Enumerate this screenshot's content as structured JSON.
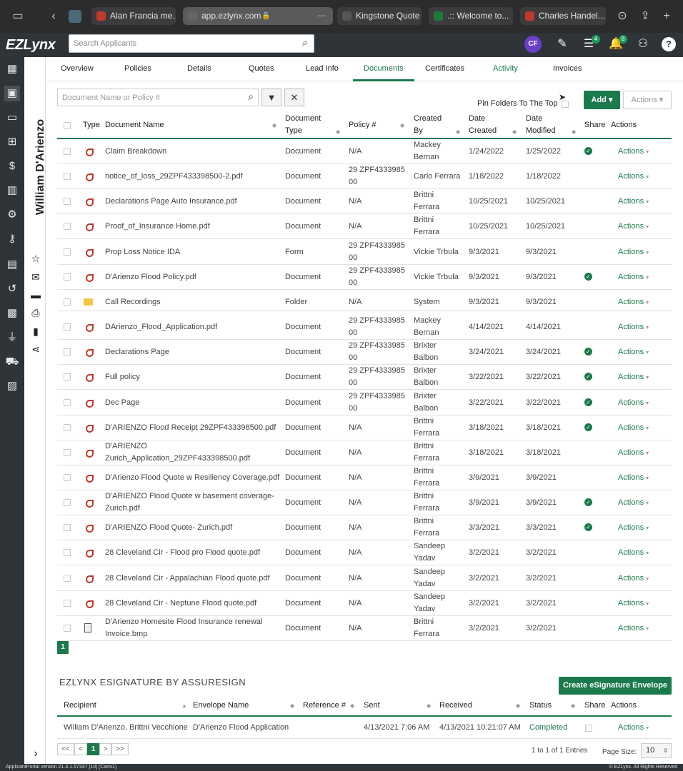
{
  "browser": {
    "tabs": [
      {
        "label": "Alan Francia me...",
        "favicon_color": "#c0392b"
      },
      {
        "label": "app.ezlynx.com",
        "favicon_color": "#666666"
      },
      {
        "label": "Kingstone Quote",
        "favicon_color": "#555555"
      },
      {
        "label": ".:: Welcome to...",
        "favicon_color": "#1e7a3c"
      },
      {
        "label": "Charles Handel...",
        "favicon_color": "#c0392b"
      }
    ]
  },
  "header": {
    "logo": "EZLynx",
    "search_placeholder": "Search Applicants",
    "avatar_initials": "CF",
    "tasks_badge": "4",
    "notifications_badge": "8",
    "help_icon": "?"
  },
  "applicant_name": "William D'Arienzo",
  "nav_tabs": [
    "Overview",
    "Policies",
    "Details",
    "Quotes",
    "Lead Info",
    "Documents",
    "Certificates",
    "Activity",
    "Invoices"
  ],
  "documents": {
    "search_placeholder": "Document Name or Policy #",
    "pin_label": "Pin Folders To The Top",
    "add_label": "Add",
    "actions_label": "Actions",
    "columns": {
      "type": "Type",
      "name": "Document Name",
      "doctype_1": "Document",
      "doctype_2": "Type",
      "policy": "Policy #",
      "created_by_1": "Created",
      "created_by_2": "By",
      "date_created_1": "Date",
      "date_created_2": "Created",
      "date_modified_1": "Date",
      "date_modified_2": "Modified",
      "share": "Share",
      "actions": "Actions"
    },
    "rows": [
      {
        "name1": "Claim Breakdown",
        "name2": "",
        "doctype": "Document",
        "policy1": "N/A",
        "policy2": "",
        "by1": "Mackey",
        "by2": "Bernan",
        "created": "1/24/2022",
        "modified": "1/25/2022",
        "shared": true,
        "icon": "pdf",
        "action": "Actions"
      },
      {
        "name1": "notice_of_loss_29ZPF433398500-2.pdf",
        "name2": "",
        "doctype": "Document",
        "policy1": "29 ZPF4333985",
        "policy2": "00",
        "by1": "Carlo Ferrara",
        "by2": "",
        "created": "1/18/2022",
        "modified": "1/18/2022",
        "shared": false,
        "icon": "pdf",
        "action": "Actions"
      },
      {
        "name1": "Declarations Page Auto Insurance.pdf",
        "name2": "",
        "doctype": "Document",
        "policy1": "N/A",
        "policy2": "",
        "by1": "Brittni",
        "by2": "Ferrara",
        "created": "10/25/2021",
        "modified": "10/25/2021",
        "shared": false,
        "icon": "pdf",
        "action": "Actions"
      },
      {
        "name1": "Proof_of_Insurance Home.pdf",
        "name2": "",
        "doctype": "Document",
        "policy1": "N/A",
        "policy2": "",
        "by1": "Brittni",
        "by2": "Ferrara",
        "created": "10/25/2021",
        "modified": "10/25/2021",
        "shared": false,
        "icon": "pdf",
        "action": "Actions"
      },
      {
        "name1": "Prop Loss Notice IDA",
        "name2": "",
        "doctype": "Form",
        "policy1": "29 ZPF4333985",
        "policy2": "00",
        "by1": "Vickie Trbula",
        "by2": "",
        "created": "9/3/2021",
        "modified": "9/3/2021",
        "shared": false,
        "icon": "pdf",
        "action": "Actions"
      },
      {
        "name1": "D'Arienzo Flood Policy.pdf",
        "name2": "",
        "doctype": "Document",
        "policy1": "29 ZPF4333985",
        "policy2": "00",
        "by1": "Vickie Trbula",
        "by2": "",
        "created": "9/3/2021",
        "modified": "9/3/2021",
        "shared": true,
        "icon": "pdf",
        "action": "Actions"
      },
      {
        "name1": "Call Recordings",
        "name2": "",
        "doctype": "Folder",
        "policy1": "N/A",
        "policy2": "",
        "by1": "System",
        "by2": "",
        "created": "9/3/2021",
        "modified": "9/3/2021",
        "shared": false,
        "icon": "folder",
        "action": "Actions"
      },
      {
        "name1": "DArienzo_Flood_Application.pdf",
        "name2": "",
        "doctype": "Document",
        "policy1": "29 ZPF4333985",
        "policy2": "00",
        "by1": "Mackey",
        "by2": "Bernan",
        "created": "4/14/2021",
        "modified": "4/14/2021",
        "shared": false,
        "icon": "pdf",
        "action": "Actions"
      },
      {
        "name1": "Declarations Page",
        "name2": "",
        "doctype": "Document",
        "policy1": "29 ZPF4333985",
        "policy2": "00",
        "by1": "Brixter",
        "by2": "Balbon",
        "created": "3/24/2021",
        "modified": "3/24/2021",
        "shared": true,
        "icon": "pdf",
        "action": "Actions"
      },
      {
        "name1": "Full policy",
        "name2": "",
        "doctype": "Document",
        "policy1": "29 ZPF4333985",
        "policy2": "00",
        "by1": "Brixter",
        "by2": "Balbon",
        "created": "3/22/2021",
        "modified": "3/22/2021",
        "shared": true,
        "icon": "pdf",
        "action": "Actions"
      },
      {
        "name1": "Dec Page",
        "name2": "",
        "doctype": "Document",
        "policy1": "29 ZPF4333985",
        "policy2": "00",
        "by1": "Brixter",
        "by2": "Balbon",
        "created": "3/22/2021",
        "modified": "3/22/2021",
        "shared": true,
        "icon": "pdf",
        "action": "Actions"
      },
      {
        "name1": "D'ARIENZO Flood Receipt 29ZPF433398500.pdf",
        "name2": "",
        "doctype": "Document",
        "policy1": "N/A",
        "policy2": "",
        "by1": "Brittni",
        "by2": "Ferrara",
        "created": "3/18/2021",
        "modified": "3/18/2021",
        "shared": true,
        "icon": "pdf",
        "action": "Actions"
      },
      {
        "name1": "D'ARIENZO",
        "name2": "Zurich_Application_29ZPF433398500.pdf",
        "doctype": "Document",
        "policy1": "N/A",
        "policy2": "",
        "by1": "Brittni",
        "by2": "Ferrara",
        "created": "3/18/2021",
        "modified": "3/18/2021",
        "shared": false,
        "icon": "pdf",
        "action": "Actions"
      },
      {
        "name1": "D'Arienzo Flood Quote w Resiliency Coverage.pdf",
        "name2": "",
        "doctype": "Document",
        "policy1": "N/A",
        "policy2": "",
        "by1": "Brittni",
        "by2": "Ferrara",
        "created": "3/9/2021",
        "modified": "3/9/2021",
        "shared": false,
        "icon": "pdf",
        "action": "Actions"
      },
      {
        "name1": "D'ARIENZO Flood Quote w basement coverage-",
        "name2": "Zurich.pdf",
        "doctype": "Document",
        "policy1": "N/A",
        "policy2": "",
        "by1": "Brittni",
        "by2": "Ferrara",
        "created": "3/9/2021",
        "modified": "3/9/2021",
        "shared": true,
        "icon": "pdf",
        "action": "Actions"
      },
      {
        "name1": "D'ARIENZO Flood Quote- Zurich.pdf",
        "name2": "",
        "doctype": "Document",
        "policy1": "N/A",
        "policy2": "",
        "by1": "Brittni",
        "by2": "Ferrara",
        "created": "3/3/2021",
        "modified": "3/3/2021",
        "shared": true,
        "icon": "pdf",
        "action": "Actions"
      },
      {
        "name1": "28 Cleveland Cir - Flood pro Flood quote.pdf",
        "name2": "",
        "doctype": "Document",
        "policy1": "N/A",
        "policy2": "",
        "by1": "Sandeep",
        "by2": "Yadav",
        "created": "3/2/2021",
        "modified": "3/2/2021",
        "shared": false,
        "icon": "pdf",
        "action": "Actions"
      },
      {
        "name1": "28 Cleveland Cir - Appalachian Flood quote.pdf",
        "name2": "",
        "doctype": "Document",
        "policy1": "N/A",
        "policy2": "",
        "by1": "Sandeep",
        "by2": "Yadav",
        "created": "3/2/2021",
        "modified": "3/2/2021",
        "shared": false,
        "icon": "pdf",
        "action": "Actions"
      },
      {
        "name1": "28 Cleveland Cir - Neptune Flood quote.pdf",
        "name2": "",
        "doctype": "Document",
        "policy1": "N/A",
        "policy2": "",
        "by1": "Sandeep",
        "by2": "Yadav",
        "created": "3/2/2021",
        "modified": "3/2/2021",
        "shared": false,
        "icon": "pdf",
        "action": "Actions"
      },
      {
        "name1": "D'Arienzo Homesite Flood Insurance renewal",
        "name2": "Invoice.bmp",
        "doctype": "Document",
        "policy1": "N/A",
        "policy2": "",
        "by1": "Brittni",
        "by2": "Ferrara",
        "created": "3/2/2021",
        "modified": "3/2/2021",
        "shared": false,
        "icon": "bmp",
        "action": "Actions"
      }
    ],
    "page": "1"
  },
  "esignature": {
    "title": "EZLYNX ESIGNATURE BY ASSURESIGN",
    "create_label": "Create eSignature Envelope",
    "columns": {
      "recipient": "Recipient",
      "envelope": "Envelope Name",
      "reference": "Reference #",
      "sent": "Sent",
      "received": "Received",
      "status": "Status",
      "share": "Share",
      "actions": "Actions"
    },
    "row": {
      "recipient": "William D'Arienzo, Brittni Vecchione",
      "envelope": "D'Arienzo Flood Application",
      "sent": "4/13/2021 7:06 AM",
      "received": "4/13/2021 10:21:07 AM",
      "status": "Completed",
      "action": "Actions"
    },
    "pager": {
      "first": "<<",
      "prev": "<",
      "current": "1",
      "next": ">",
      "last": ">>"
    },
    "entries": "1 to 1 of 1 Entries",
    "page_size_label": "Page Size:",
    "page_size": "10"
  },
  "footer": {
    "version": "ApplicantPortal version 21.3.1.57337 [10] (Carlo1)",
    "copyright": "© EZLynx. All Rights Reserved"
  },
  "colors": {
    "accent": "#1a7a4c",
    "nav_bg": "#2e3438"
  }
}
